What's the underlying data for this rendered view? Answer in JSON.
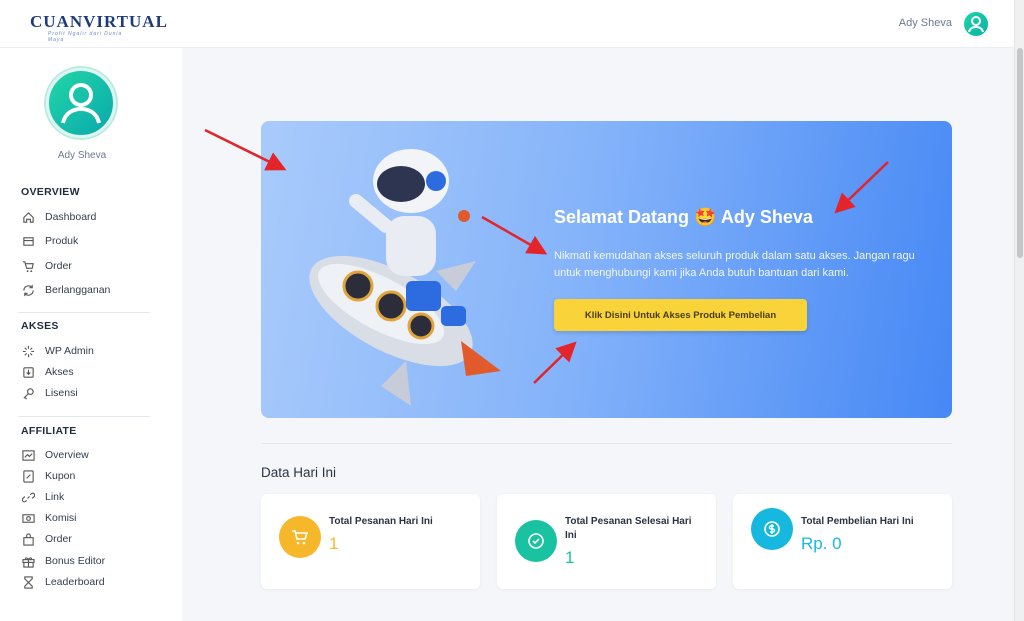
{
  "header": {
    "logo_text": "CUANVIRTUAL",
    "logo_tagline": "Profit Ngalir dari Dunia Maya",
    "user_name": "Ady Sheva"
  },
  "sidebar": {
    "user_name": "Ady Sheva",
    "sections": {
      "overview": {
        "title": "OVERVIEW",
        "items": [
          "Dashboard",
          "Produk",
          "Order",
          "Berlangganan"
        ]
      },
      "akses": {
        "title": "AKSES",
        "items": [
          "WP Admin",
          "Akses",
          "Lisensi"
        ]
      },
      "affiliate": {
        "title": "AFFILIATE",
        "items": [
          "Overview",
          "Kupon",
          "Link",
          "Komisi",
          "Order",
          "Bonus Editor",
          "Leaderboard"
        ]
      }
    }
  },
  "hero": {
    "greeting": "Selamat Datang",
    "emoji": "🤩",
    "user_name": "Ady Sheva",
    "text": "Nikmati kemudahan akses seluruh produk dalam satu akses. Jangan ragu untuk menghubungi kami jika Anda butuh bantuan dari kami.",
    "button_label": "Klik Disini Untuk Akses Produk Pembelian"
  },
  "stats": {
    "section_title": "Data Hari Ini",
    "cards": [
      {
        "label": "Total Pesanan Hari Ini",
        "value": "1",
        "color": "#f6b82a",
        "icon": "cart-icon"
      },
      {
        "label": "Total Pesanan Selesai Hari Ini",
        "value": "1",
        "color": "#19c2a0",
        "icon": "check-badge-icon"
      },
      {
        "label": "Total Pembelian Hari Ini",
        "value": "Rp. 0",
        "color": "#17b8e0",
        "icon": "dollar-icon"
      }
    ]
  },
  "colors": {
    "brand": "#1f3a7a",
    "accent": "#4688f5",
    "button": "#f8d33a",
    "arrow": "#e3242b"
  }
}
